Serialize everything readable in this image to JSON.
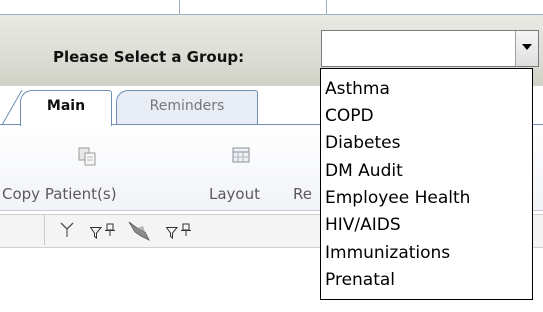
{
  "group_selector": {
    "label": "Please Select a Group:",
    "value": ""
  },
  "dropdown": {
    "options": [
      "Asthma",
      "COPD",
      "Diabetes",
      "DM Audit",
      "Employee Health",
      "HIV/AIDS",
      "Immunizations",
      "Prenatal"
    ]
  },
  "tabs": [
    {
      "label": "Main",
      "active": true
    },
    {
      "label": "Reminders",
      "active": false
    }
  ],
  "ribbon": {
    "copy_label": "Copy Patient(s)",
    "layout_label": "Layout",
    "cut_label": "Re"
  },
  "icons": {
    "copy": "copy-icon",
    "layout": "layout-grid-icon",
    "toolbar": [
      "flag-icon",
      "filter-icon",
      "pin-icon",
      "bird-icon",
      "filter-icon",
      "pin-icon"
    ]
  }
}
